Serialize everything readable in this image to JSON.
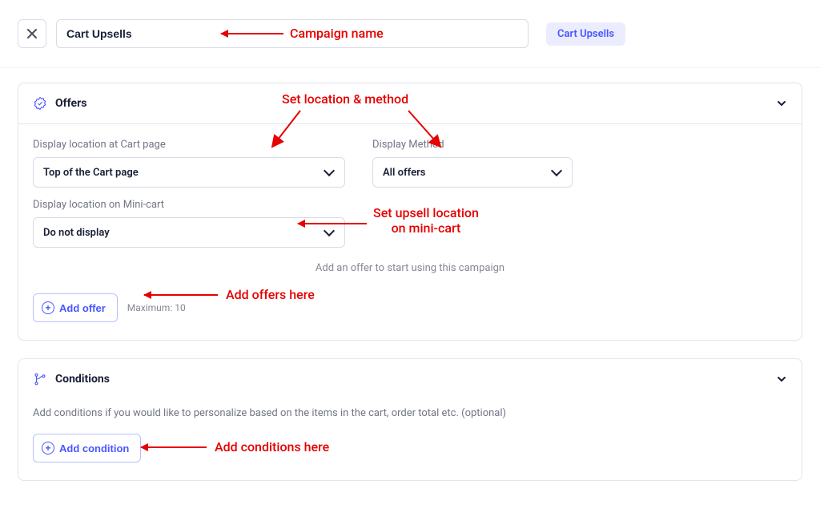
{
  "header": {
    "campaign_name": "Cart Upsells",
    "type_chip": "Cart Upsells"
  },
  "offers_panel": {
    "title": "Offers",
    "location_cart_label": "Display location at Cart page",
    "location_cart_value": "Top of the Cart page",
    "display_method_label": "Display Method",
    "display_method_value": "All offers",
    "location_mini_label": "Display location on Mini-cart",
    "location_mini_value": "Do not display",
    "empty_hint": "Add an offer to start using this campaign",
    "add_offer_label": "Add offer",
    "max_note": "Maximum: 10"
  },
  "conditions_panel": {
    "title": "Conditions",
    "help_text": "Add conditions if you would like to personalize based on the items in the cart, order total etc. (optional)",
    "add_condition_label": "Add condition"
  },
  "annotations": {
    "campaign_name": "Campaign name",
    "location_method": "Set location & method",
    "mini_cart": "Set upsell location\non mini-cart",
    "add_offers": "Add offers here",
    "add_conditions": "Add conditions here"
  }
}
